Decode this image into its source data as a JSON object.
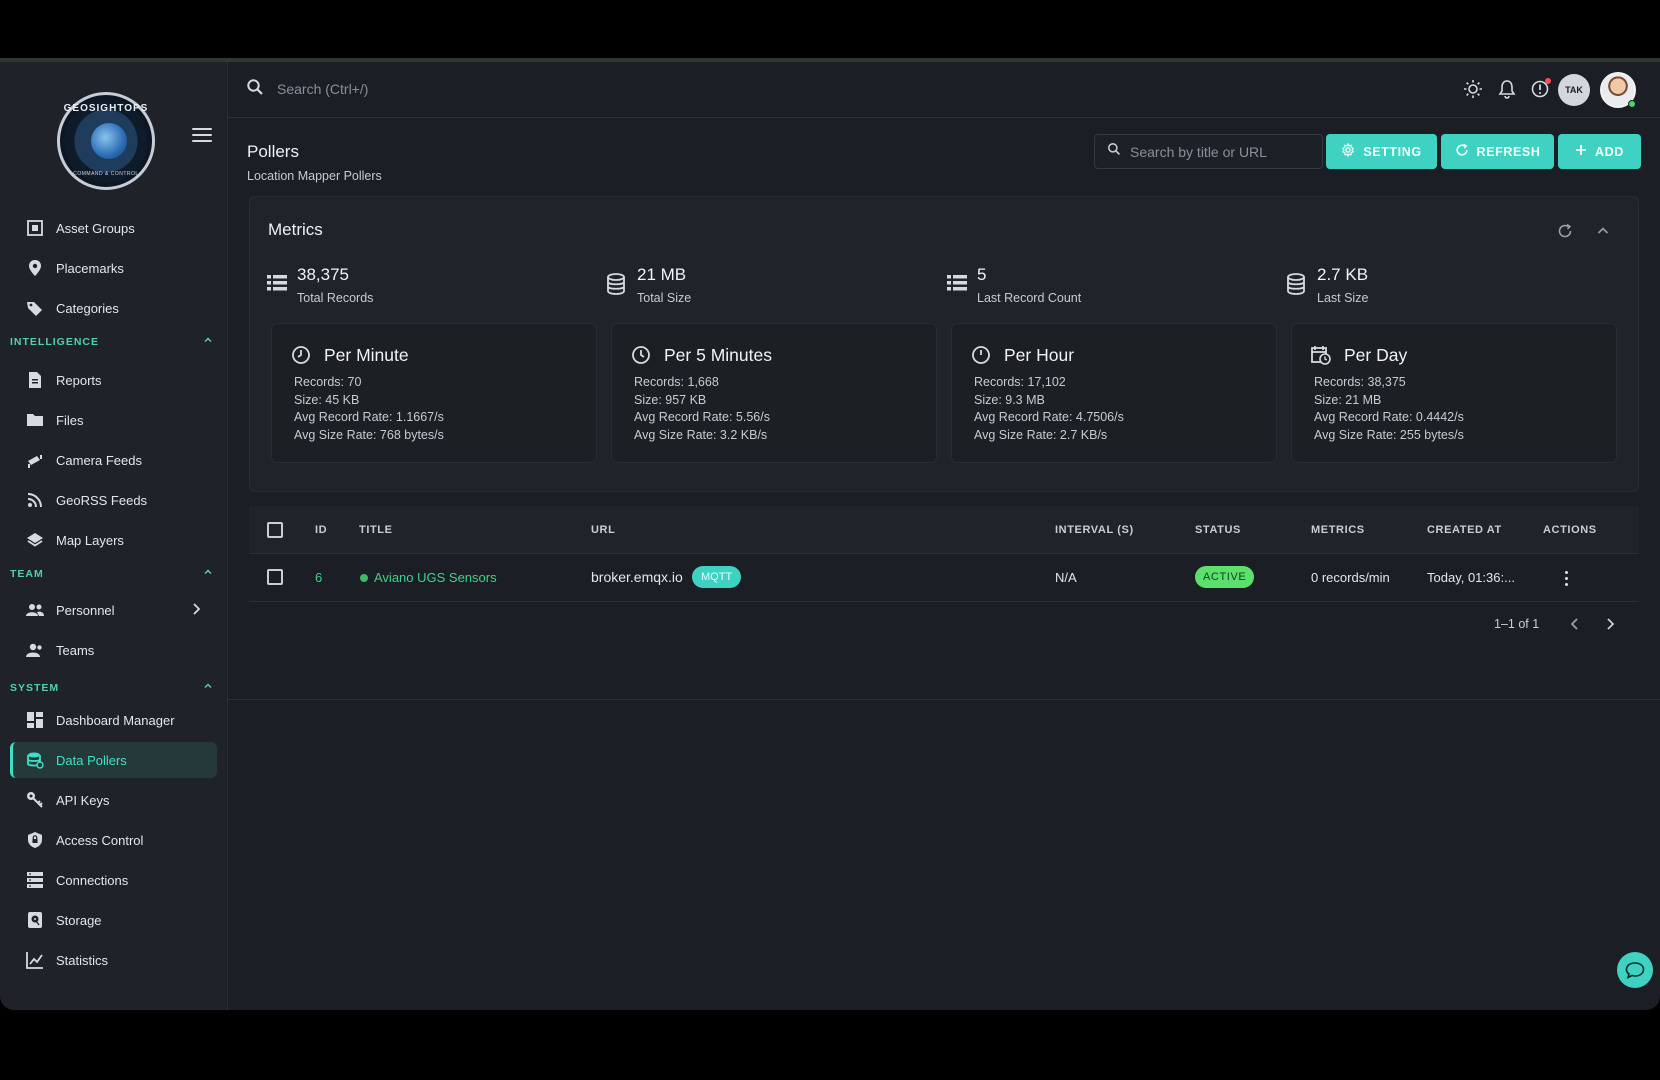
{
  "sidebar": {
    "logo": {
      "text": "GEOSIGHTOPS",
      "subtext": "COMMAND & CONTROL"
    },
    "items_top": [
      {
        "label": "Asset Groups",
        "icon": "asset-groups-icon"
      },
      {
        "label": "Placemarks",
        "icon": "map-pin-icon"
      },
      {
        "label": "Categories",
        "icon": "tags-icon"
      }
    ],
    "sections": {
      "intelligence": "INTELLIGENCE",
      "team": "TEAM",
      "system": "SYSTEM"
    },
    "items_intelligence": [
      {
        "label": "Reports",
        "icon": "report-icon"
      },
      {
        "label": "Files",
        "icon": "folder-icon"
      },
      {
        "label": "Camera Feeds",
        "icon": "camera-icon"
      },
      {
        "label": "GeoRSS Feeds",
        "icon": "rss-icon"
      },
      {
        "label": "Map Layers",
        "icon": "layers-icon"
      }
    ],
    "items_team": [
      {
        "label": "Personnel",
        "icon": "people-icon"
      },
      {
        "label": "Teams",
        "icon": "team-icon"
      }
    ],
    "items_system": [
      {
        "label": "Dashboard Manager",
        "icon": "dashboard-icon"
      },
      {
        "label": "Data Pollers",
        "icon": "database-icon",
        "active": true
      },
      {
        "label": "API Keys",
        "icon": "key-icon"
      },
      {
        "label": "Access Control",
        "icon": "shield-lock-icon"
      },
      {
        "label": "Connections",
        "icon": "server-icon"
      },
      {
        "label": "Storage",
        "icon": "storage-icon"
      },
      {
        "label": "Statistics",
        "icon": "chart-icon"
      }
    ]
  },
  "topbar": {
    "search_placeholder": "Search (Ctrl+/)",
    "tak_label": "TAK"
  },
  "header": {
    "title": "Pollers",
    "subtitle": "Location Mapper Pollers",
    "search_placeholder": "Search by title or URL",
    "buttons": {
      "setting": "SETTING",
      "refresh": "REFRESH",
      "add": "ADD"
    }
  },
  "metrics": {
    "title": "Metrics",
    "summary": [
      {
        "value": "38,375",
        "label": "Total Records"
      },
      {
        "value": "21 MB",
        "label": "Total Size"
      },
      {
        "value": "5",
        "label": "Last Record Count"
      },
      {
        "value": "2.7 KB",
        "label": "Last Size"
      }
    ],
    "rates": [
      {
        "title": "Per Minute",
        "records": "Records: 70",
        "size": "Size: 45 KB",
        "record_rate": "Avg Record Rate: 1.1667/s",
        "size_rate": "Avg Size Rate: 768 bytes/s"
      },
      {
        "title": "Per 5 Minutes",
        "records": "Records: 1,668",
        "size": "Size: 957 KB",
        "record_rate": "Avg Record Rate: 5.56/s",
        "size_rate": "Avg Size Rate: 3.2 KB/s"
      },
      {
        "title": "Per Hour",
        "records": "Records: 17,102",
        "size": "Size: 9.3 MB",
        "record_rate": "Avg Record Rate: 4.7506/s",
        "size_rate": "Avg Size Rate: 2.7 KB/s"
      },
      {
        "title": "Per Day",
        "records": "Records: 38,375",
        "size": "Size: 21 MB",
        "record_rate": "Avg Record Rate: 0.4442/s",
        "size_rate": "Avg Size Rate: 255 bytes/s"
      }
    ]
  },
  "table": {
    "columns": [
      "ID",
      "TITLE",
      "URL",
      "INTERVAL (S)",
      "STATUS",
      "METRICS",
      "CREATED AT",
      "ACTIONS"
    ],
    "rows": [
      {
        "id": "6",
        "title": "Aviano UGS Sensors",
        "url": "broker.emqx.io",
        "protocol": "MQTT",
        "interval": "N/A",
        "status": "ACTIVE",
        "metrics": "0 records/min",
        "created_at": "Today, 01:36:..."
      }
    ],
    "pagination": "1–1 of 1"
  },
  "colors": {
    "accent": "#3fd2c3",
    "active_status": "#5ae06b",
    "background": "#1b1f25"
  }
}
